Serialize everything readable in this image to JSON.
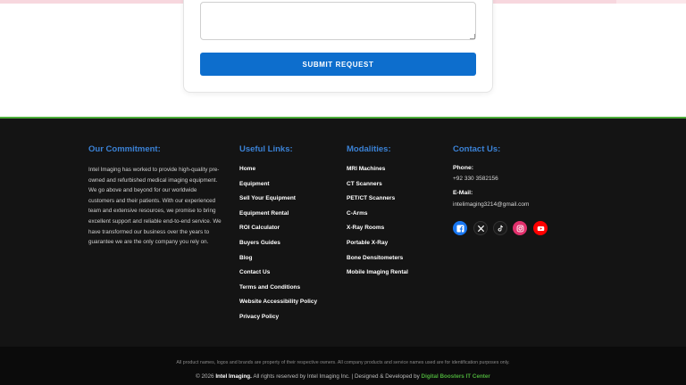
{
  "form": {
    "submit_label": "SUBMIT REQUEST"
  },
  "footer": {
    "commitment": {
      "title": "Our Commitment:",
      "text": "Intel Imaging has worked to provide high-quality pre-owned and refurbished medical imaging equipment. We go above and beyond for our worldwide customers and their patients. With our experienced team and extensive resources, we promise to bring excellent support and reliable end-to-end service. We have transformed our business over the years to guarantee we are the only company you rely on."
    },
    "useful_links": {
      "title": "Useful Links:",
      "items": [
        "Home",
        "Equipment",
        "Sell Your Equipment",
        "Equipment Rental",
        "ROI Calculator",
        "Buyers Guides",
        "Blog",
        "Contact Us",
        "Terms and Conditions",
        "Website Accessibility Policy",
        "Privacy Policy"
      ]
    },
    "modalities": {
      "title": "Modalities:",
      "items": [
        "MRI Machines",
        "CT Scanners",
        "PET/CT Scanners",
        "C-Arms",
        "X-Ray Rooms",
        "Portable X-Ray",
        "Bone Densitometers",
        "Mobile Imaging Rental"
      ]
    },
    "contact": {
      "title": "Contact Us:",
      "phone_label": "Phone:",
      "phone": "+92 330 3582156",
      "email_label": "E-Mail:",
      "email": "intelimaging3214@gmail.com"
    },
    "social": [
      {
        "icon": "facebook-icon",
        "color": "#1877f2"
      },
      {
        "icon": "x-icon",
        "color": "#1a1a1a"
      },
      {
        "icon": "tiktok-icon",
        "color": "#1a1a1a"
      },
      {
        "icon": "instagram-icon",
        "color": "#e1306c"
      },
      {
        "icon": "youtube-icon",
        "color": "#ff0000"
      }
    ],
    "legal": "All product names, logos and brands are property of their respective owners. All company products and service names used are for identification purposes only.",
    "copyright_prefix": "© 2026",
    "copyright_brand": "Intel Imaging.",
    "copyright_middle": "All rights reserved by Intel Imaging Inc. | Designed & Developed by",
    "copyright_dev": "Digital Boosters IT Center"
  },
  "colors": {
    "accent_blue": "#3b82d6",
    "button_blue": "#0d6ecd",
    "footer_bg": "#141414",
    "green": "#4cae3a"
  }
}
